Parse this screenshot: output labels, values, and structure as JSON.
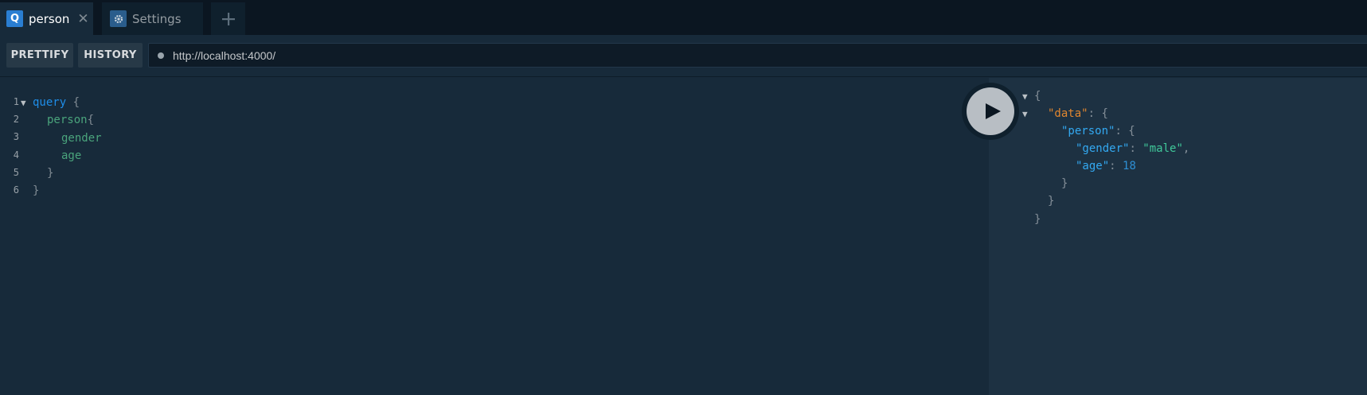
{
  "tabs": [
    {
      "badge": "Q",
      "label": "person",
      "close": "✕",
      "active": true
    },
    {
      "label": "Settings",
      "active": false
    }
  ],
  "add_tab_icon": "plus-icon",
  "toolbar": {
    "prettify_label": "PRETTIFY",
    "history_label": "HISTORY",
    "endpoint": "http://localhost:4000/"
  },
  "editor": {
    "lines": [
      {
        "num": "1",
        "text": "query"
      },
      {
        "num": "2",
        "text": "person"
      },
      {
        "num": "3",
        "text": "gender"
      },
      {
        "num": "4",
        "text": "age"
      },
      {
        "num": "5",
        "text": "}"
      },
      {
        "num": "6",
        "text": "}"
      }
    ],
    "open_brace": "{",
    "close_brace": "}"
  },
  "result": {
    "data_key": "\"data\"",
    "person_key": "\"person\"",
    "gender_key": "\"gender\"",
    "gender_value": "\"male\"",
    "age_key": "\"age\"",
    "age_value": "18"
  },
  "colors": {
    "keyword": "#1f8ee9",
    "field": "#4aa47c",
    "result_key": "#33a9f2",
    "data_key": "#e1862f",
    "string": "#40c89a",
    "badge": "#2a7ed2"
  },
  "icons": {
    "execute": "play-icon",
    "settings": "gear-icon",
    "close": "close-icon"
  }
}
